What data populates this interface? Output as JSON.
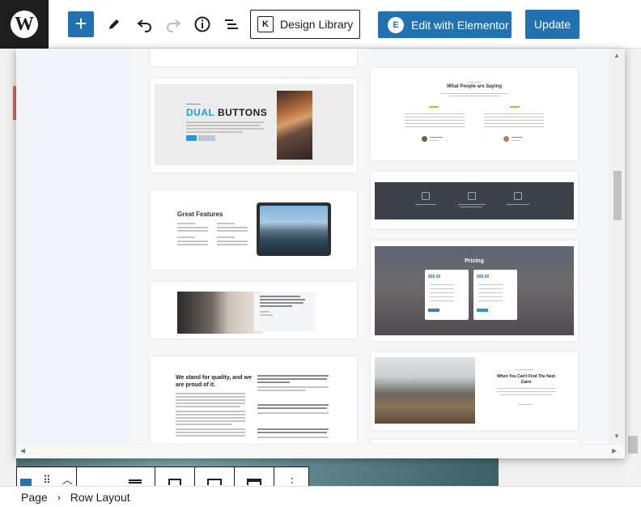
{
  "toolbar": {
    "design_library_label": "Design Library",
    "design_library_icon": "K",
    "elementor_label": "Edit with Elementor",
    "elementor_icon": "E",
    "update_label": "Update",
    "add_symbol": "+"
  },
  "breadcrumb": {
    "page": "Page",
    "separator": "›",
    "current": "Row Layout"
  },
  "designs": {
    "dual_buttons": {
      "heading_primary": "DUAL",
      "heading_secondary": "BUTTONS"
    },
    "great_features": {
      "title": "Great Features"
    },
    "quality": {
      "heading_line1": "We stand for quality, and we",
      "heading_line2": "are proud of it."
    },
    "testimonials": {
      "title": "What People are Saying"
    },
    "pricing": {
      "title": "Pricing",
      "price_left": "$55.00",
      "price_right": "$90.00"
    },
    "featured": {
      "title_line1": "When You Can't Find The Next",
      "title_line2": "Cairn"
    }
  },
  "colors": {
    "wp_blue": "#2271b1",
    "dark": "#1e1e1e",
    "accent_cyan": "#1d9dd8"
  }
}
